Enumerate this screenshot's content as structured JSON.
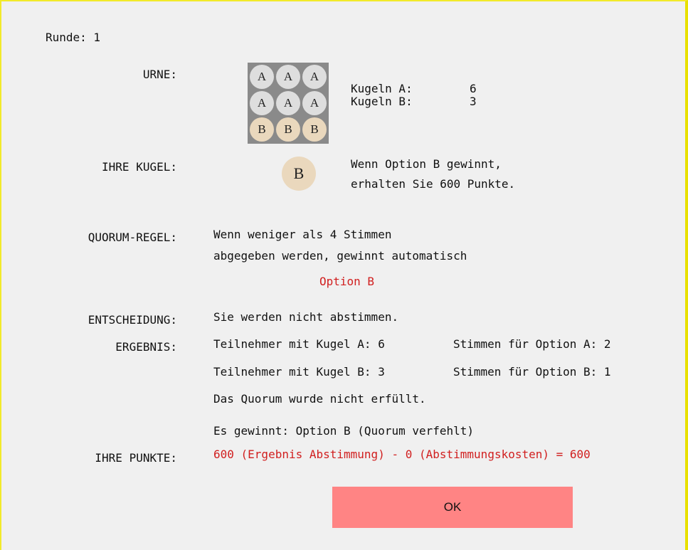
{
  "round": "Runde: 1",
  "labels": {
    "urn": "URNE:",
    "your_ball": "IHRE KUGEL:",
    "quorum_rule": "QUORUM-REGEL:",
    "decision": "ENTSCHEIDUNG:",
    "result": "ERGEBNIS:",
    "your_points": "IHRE PUNKTE:"
  },
  "urn": {
    "balls": [
      "A",
      "A",
      "A",
      "A",
      "A",
      "A",
      "B",
      "B",
      "B"
    ],
    "count_a_label": "Kugeln A:",
    "count_a_value": "6",
    "count_b_label": "Kugeln B:",
    "count_b_value": "3"
  },
  "your_ball": {
    "letter": "B",
    "text_line1": "Wenn Option B gewinnt,",
    "text_line2": "erhalten Sie 600 Punkte."
  },
  "quorum": {
    "line1": "Wenn weniger als 4 Stimmen",
    "line2": "abgegeben werden, gewinnt automatisch",
    "option": "Option B"
  },
  "decision": "Sie werden nicht abstimmen.",
  "result": {
    "participants_a": "Teilnehmer mit Kugel A: 6",
    "votes_a": "Stimmen für Option A: 2",
    "participants_b": "Teilnehmer mit Kugel B: 3",
    "votes_b": "Stimmen für Option B: 1",
    "quorum_status": "Das Quorum wurde nicht erfüllt.",
    "winner": "Es gewinnt: Option B (Quorum verfehlt)"
  },
  "points": "600 (Ergebnis Abstimmung) - 0 (Abstimmungskosten) = 600",
  "ok_button": "OK",
  "colors": {
    "accent_red": "#d11f1f",
    "button": "#ff8484",
    "frame": "#e8e000",
    "ball_a": "#dedede",
    "ball_b": "#ead8bd"
  }
}
